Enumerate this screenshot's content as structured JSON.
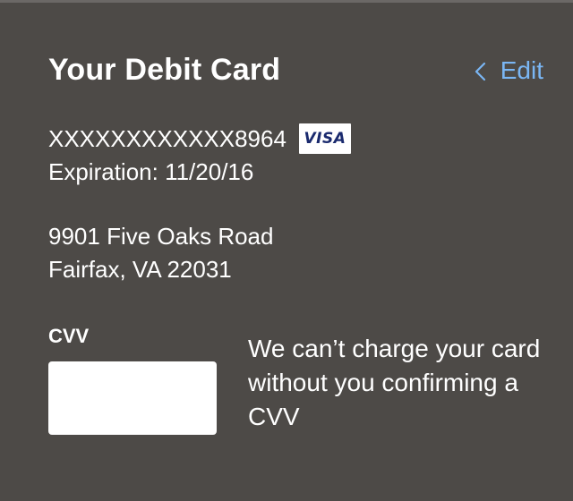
{
  "card": {
    "title": "Your Debit Card",
    "edit_label": "Edit",
    "number": "XXXXXXXXXXXX8964",
    "brand": "VISA",
    "expiration": "Expiration: 11/20/16"
  },
  "address": {
    "line1": "9901 Five Oaks Road",
    "line2": "Fairfax, VA 22031"
  },
  "cvv": {
    "label": "CVV",
    "value": "",
    "message": "We can’t charge your card without you confirming a CVV"
  },
  "colors": {
    "background": "#4d4a47",
    "accent": "#7ab6f4",
    "visa_blue": "#1a2a6e"
  },
  "icons": {
    "edit": "chevron-left-icon"
  }
}
